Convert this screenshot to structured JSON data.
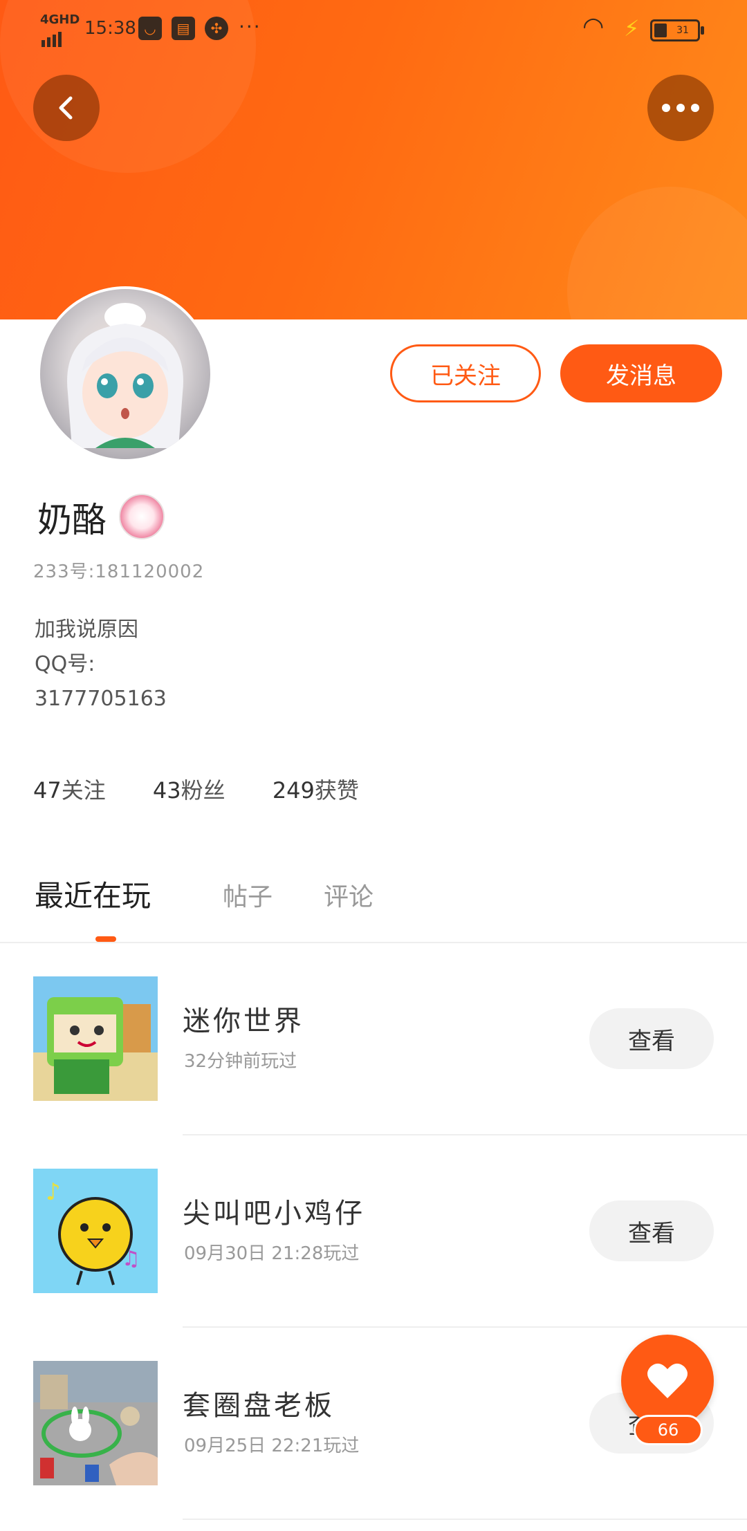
{
  "status_bar": {
    "network": "4GHD",
    "time": "15:38",
    "more": "···",
    "battery": "31"
  },
  "header": {
    "back_icon": "chevron-left-icon",
    "more_icon": "more-dots-icon"
  },
  "profile": {
    "follow_label": "已关注",
    "message_label": "发消息",
    "name": "奶酪",
    "id_text": "233号:181120002",
    "bio": [
      "加我说原因",
      "QQ号:",
      "3177705163"
    ]
  },
  "stats": [
    {
      "num": "47",
      "label": "关注"
    },
    {
      "num": "43",
      "label": "粉丝"
    },
    {
      "num": "249",
      "label": "获赞"
    }
  ],
  "tabs": [
    "最近在玩",
    "帖子",
    "评论"
  ],
  "games": [
    {
      "title": "迷你世界",
      "sub": "32分钟前玩过",
      "button": "查看"
    },
    {
      "title": "尖叫吧小鸡仔",
      "sub": "09月30日 21:28玩过",
      "button": "查看"
    },
    {
      "title": "套圈盘老板",
      "sub": "09月25日 22:21玩过",
      "button": "查看"
    }
  ],
  "fab": {
    "count": "66",
    "icon": "heart-icon"
  },
  "colors": {
    "accent": "#ff5a14",
    "banner_end": "#ff8a1a"
  }
}
